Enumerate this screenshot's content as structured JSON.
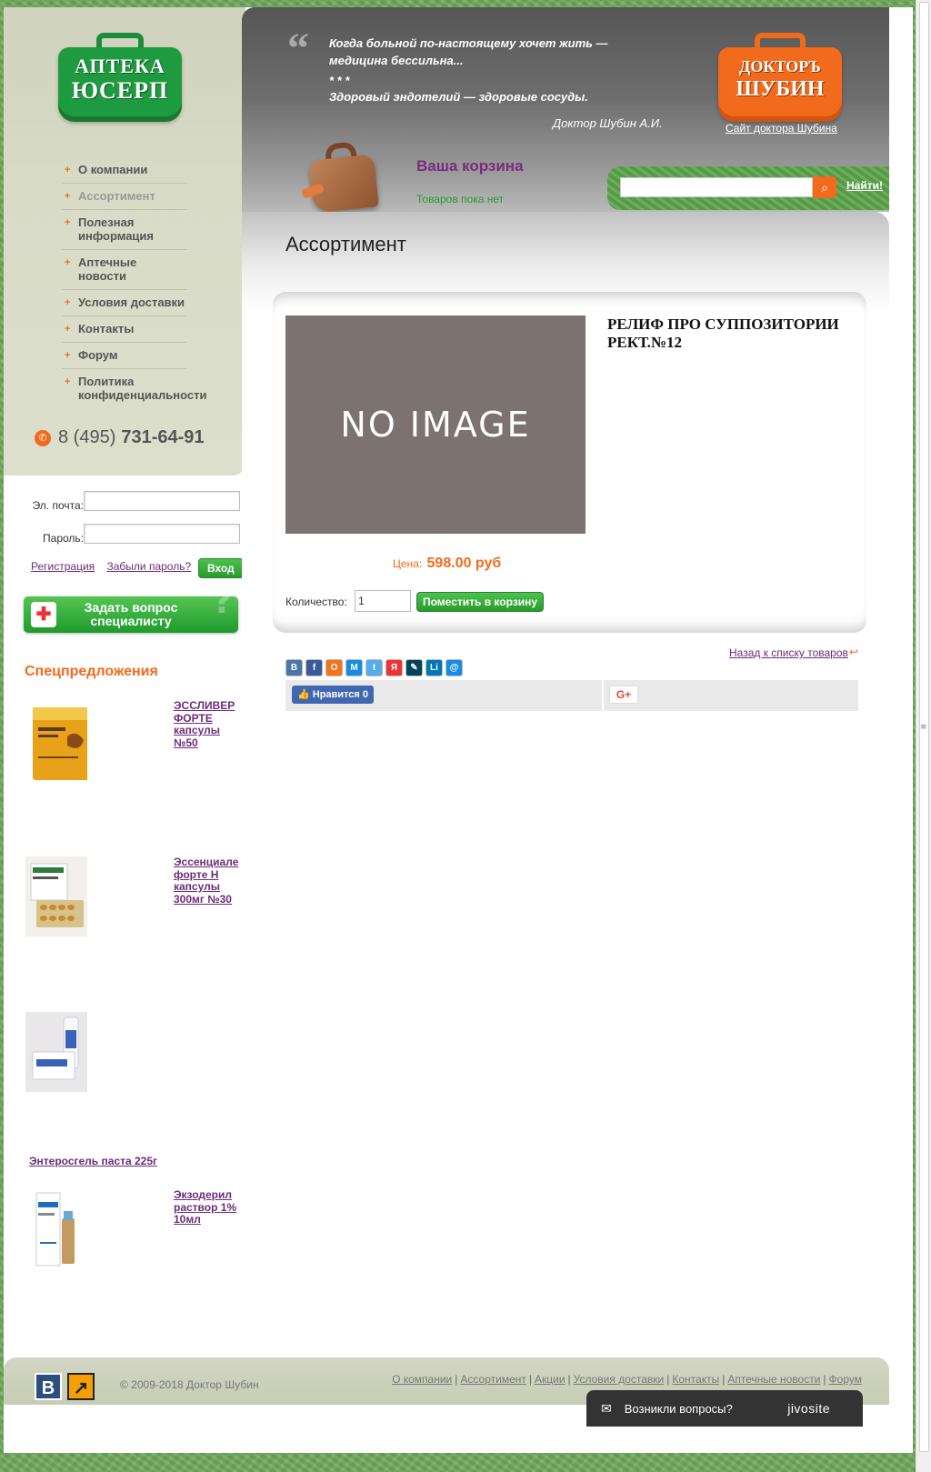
{
  "sidebar": {
    "logo": {
      "line1": "АПТЕКА",
      "line2": "ЮСЕРП"
    },
    "nav": [
      {
        "label": "О компании"
      },
      {
        "label": "Ассортимент"
      },
      {
        "label": "Полезная информация"
      },
      {
        "label": "Аптечные новости"
      },
      {
        "label": "Условия доставки"
      },
      {
        "label": "Контакты"
      },
      {
        "label": "Форум"
      },
      {
        "label": "Политика конфиденциальности"
      }
    ],
    "phone": {
      "code": "8 (495)",
      "number": "731-64-91"
    }
  },
  "login": {
    "email_label": "Эл. почта:",
    "password_label": "Пароль:",
    "register_link": "Регистрация",
    "forgot_link": "Забыли пароль?",
    "submit": "Вход"
  },
  "ask_button": {
    "line1": "Задать вопрос",
    "line2": "специалисту"
  },
  "offers": {
    "title": "Спецпредложения",
    "items": [
      {
        "name": "ЭССЛИВЕР ФОРТЕ капсулы №50"
      },
      {
        "name": "Эссенциале форте Н капсулы 300мг №30"
      },
      {
        "name": "Энтеросгель паста 225г"
      },
      {
        "name": "Экзодерил раствор 1% 10мл"
      }
    ]
  },
  "header": {
    "quote_mark": "“",
    "quote_line1": "Когда больной по-настоящему хочет жить — медицина бессильна...",
    "stars": "* * *",
    "quote_line2": "Здоровый эндотелий — здоровые сосуды.",
    "author": "Доктор Шубин А.И.",
    "doctor_logo": {
      "line1": "ДОКТОРЪ",
      "line2": "ШУБИН"
    },
    "doctor_site": "Сайт доктора Шубина",
    "cart_title": "Ваша корзина",
    "cart_status": "Товаров пока нет",
    "search_placeholder": "",
    "search_go": "Найти!"
  },
  "main": {
    "title": "Ассортимент",
    "product": {
      "image_text": "NO IMAGE",
      "name": "РЕЛИФ ПРО СУППОЗИТОРИИ РЕКТ.№12",
      "price_label": "Цена:",
      "price_value": "598.00 руб",
      "qty_label": "Количество:",
      "qty_value": "1",
      "to_cart": "Поместить в корзину"
    },
    "back_link": "Назад к списку товаров",
    "back_icon": "↩",
    "share_icons": [
      {
        "name": "vk-share-icon",
        "glyph": "В",
        "color": "#4a76a8"
      },
      {
        "name": "facebook-share-icon",
        "glyph": "f",
        "color": "#3b5998"
      },
      {
        "name": "odnoklassniki-share-icon",
        "glyph": "О",
        "color": "#f4731c"
      },
      {
        "name": "moimir-share-icon",
        "glyph": "М",
        "color": "#168de2"
      },
      {
        "name": "twitter-share-icon",
        "glyph": "t",
        "color": "#55acee"
      },
      {
        "name": "yandex-share-icon",
        "glyph": "Я",
        "color": "#e33"
      },
      {
        "name": "livejournal-share-icon",
        "glyph": "✎",
        "color": "#004359"
      },
      {
        "name": "linkedin-share-icon",
        "glyph": "Li",
        "color": "#0077b5"
      },
      {
        "name": "mail-share-icon",
        "glyph": "@",
        "color": "#168de2"
      }
    ],
    "like_label": "👍 Нравится 0",
    "gplus_label": "G+"
  },
  "footer": {
    "vk": "В",
    "arrow": "↗",
    "copyright": "© 2009-2018 Доктор Шубин",
    "links": [
      "О компании",
      "Ассортимент",
      "Акции",
      "Условия доставки",
      "Контакты",
      "Аптечные новости",
      "Форум"
    ]
  },
  "jivo": {
    "text": "Возникли вопросы?",
    "brand": "jivosite",
    "icon": "✉"
  }
}
